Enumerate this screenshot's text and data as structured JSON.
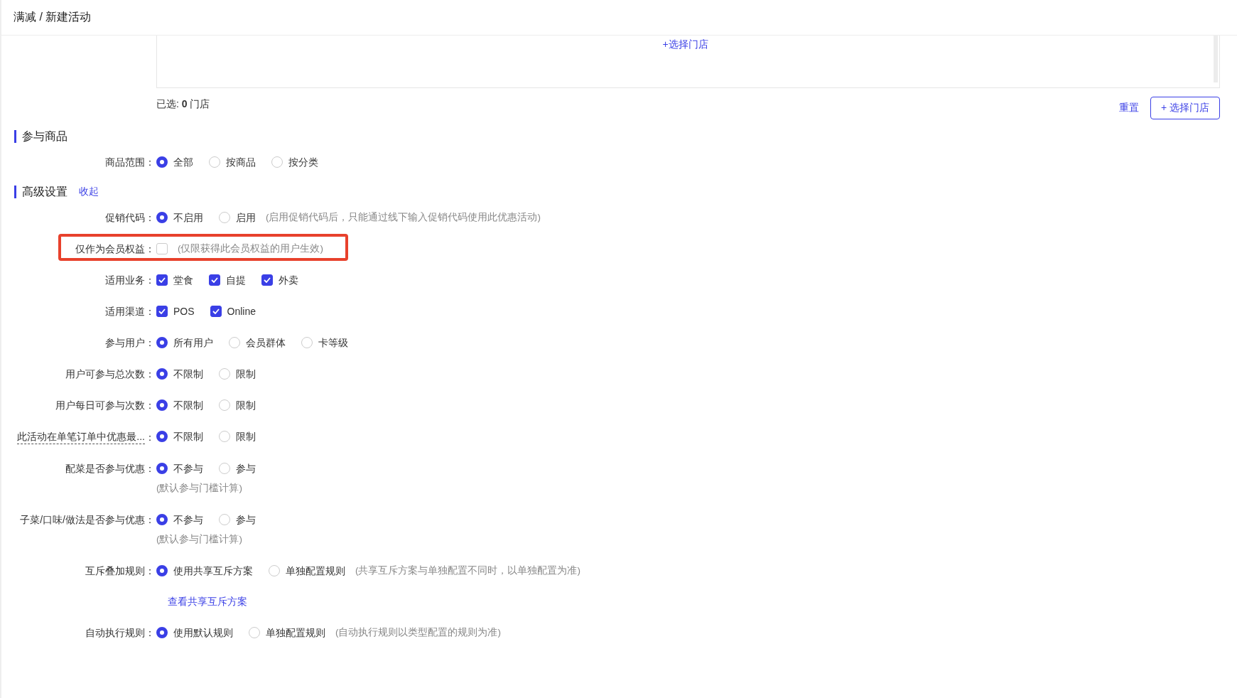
{
  "header": {
    "title": "满减 / 新建活动"
  },
  "store_picker": {
    "add_link": "+选择门店",
    "selected_summary": "已选: **0** 门店",
    "reset_link": "重置",
    "add_button": "+ 选择门店"
  },
  "sections": [
    {
      "title": "参与商品",
      "rows": [
        {
          "kind": "radio",
          "label": "商品范围：",
          "options": [
            {
              "label": "全部",
              "selected": true
            },
            {
              "label": "按商品",
              "selected": false
            },
            {
              "label": "按分类",
              "selected": false
            }
          ]
        }
      ]
    },
    {
      "title": "高级设置",
      "toggle_link": "收起",
      "rows": [
        {
          "kind": "radio",
          "label": "促销代码：",
          "options": [
            {
              "label": "不启用",
              "selected": true
            },
            {
              "label": "启用",
              "selected": false
            }
          ],
          "note": "(启用促销代码后，只能通过线下输入促销代码使用此优惠活动)"
        },
        {
          "kind": "checkbox",
          "label": "仅作为会员权益：",
          "highlighted": true,
          "options": [
            {
              "checked": false
            }
          ],
          "note": "(仅限获得此会员权益的用户生效)"
        },
        {
          "kind": "checkbox",
          "label": "适用业务：",
          "options": [
            {
              "label": "堂食",
              "checked": true
            },
            {
              "label": "自提",
              "checked": true
            },
            {
              "label": "外卖",
              "checked": true
            }
          ]
        },
        {
          "kind": "checkbox",
          "label": "适用渠道：",
          "options": [
            {
              "label": "POS",
              "checked": true
            },
            {
              "label": "Online",
              "checked": true
            }
          ]
        },
        {
          "kind": "radio",
          "label": "参与用户：",
          "options": [
            {
              "label": "所有用户",
              "selected": true
            },
            {
              "label": "会员群体",
              "selected": false
            },
            {
              "label": "卡等级",
              "selected": false
            }
          ]
        },
        {
          "kind": "radio",
          "label": "用户可参与总次数：",
          "options": [
            {
              "label": "不限制",
              "selected": true
            },
            {
              "label": "限制",
              "selected": false
            }
          ]
        },
        {
          "kind": "radio",
          "label": "用户每日可参与次数：",
          "options": [
            {
              "label": "不限制",
              "selected": true
            },
            {
              "label": "限制",
              "selected": false
            }
          ]
        },
        {
          "kind": "radio",
          "label": "此活动在单笔订单中优惠最...",
          "label_suffix": "：",
          "has_tooltip": true,
          "options": [
            {
              "label": "不限制",
              "selected": true
            },
            {
              "label": "限制",
              "selected": false
            }
          ]
        },
        {
          "kind": "radio",
          "label": "配菜是否参与优惠：",
          "options": [
            {
              "label": "不参与",
              "selected": true
            },
            {
              "label": "参与",
              "selected": false
            }
          ],
          "sub_note": "(默认参与门槛计算)"
        },
        {
          "kind": "radio",
          "label": "子菜/口味/做法是否参与优惠：",
          "options": [
            {
              "label": "不参与",
              "selected": true
            },
            {
              "label": "参与",
              "selected": false
            }
          ],
          "sub_note": "(默认参与门槛计算)"
        },
        {
          "kind": "radio",
          "label": "互斥叠加规则：",
          "options": [
            {
              "label": "使用共享互斥方案",
              "selected": true
            },
            {
              "label": "单独配置规则",
              "selected": false
            }
          ],
          "note": "(共享互斥方案与单独配置不同时，以单独配置为准)"
        },
        {
          "kind": "link",
          "link": "查看共享互斥方案"
        },
        {
          "kind": "radio",
          "label": "自动执行规则：",
          "options": [
            {
              "label": "使用默认规则",
              "selected": true
            },
            {
              "label": "单独配置规则",
              "selected": false
            }
          ],
          "note": "(自动执行规则以类型配置的规则为准)"
        }
      ]
    }
  ]
}
